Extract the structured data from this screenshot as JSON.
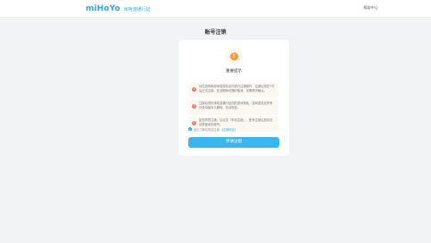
{
  "header": {
    "logo": "miHoYo",
    "logo_sub": "米哈游通行证",
    "help": "帮助中心"
  },
  "page": {
    "title": "账号注销"
  },
  "card": {
    "warning_icon": "!",
    "warning_title": "重要提示",
    "notices": [
      {
        "icon": "!",
        "text": "请在游戏和原米哈游社区内进行注销操作，注销后将在7天后正式注销，在此期间可随时取消，无需再次确认。"
      },
      {
        "icon": "!",
        "text": "注销后您的米哈游通行证内的游戏角色、游戏道具及所有记录将被永久删除，无法恢复。"
      },
      {
        "icon": "!",
        "text": "如您同意注销，请点击「申请注销」，账号注销后您将无法再使用本账号。"
      }
    ],
    "agree_text": "我已了解并同意注销",
    "agree_link": "《注销协议》",
    "apply_button": "申请注销"
  },
  "colors": {
    "accent": "#2ea7e0",
    "button": "#39b6f0",
    "warning": "#f59a3a",
    "notice_dot": "#f0786e"
  }
}
